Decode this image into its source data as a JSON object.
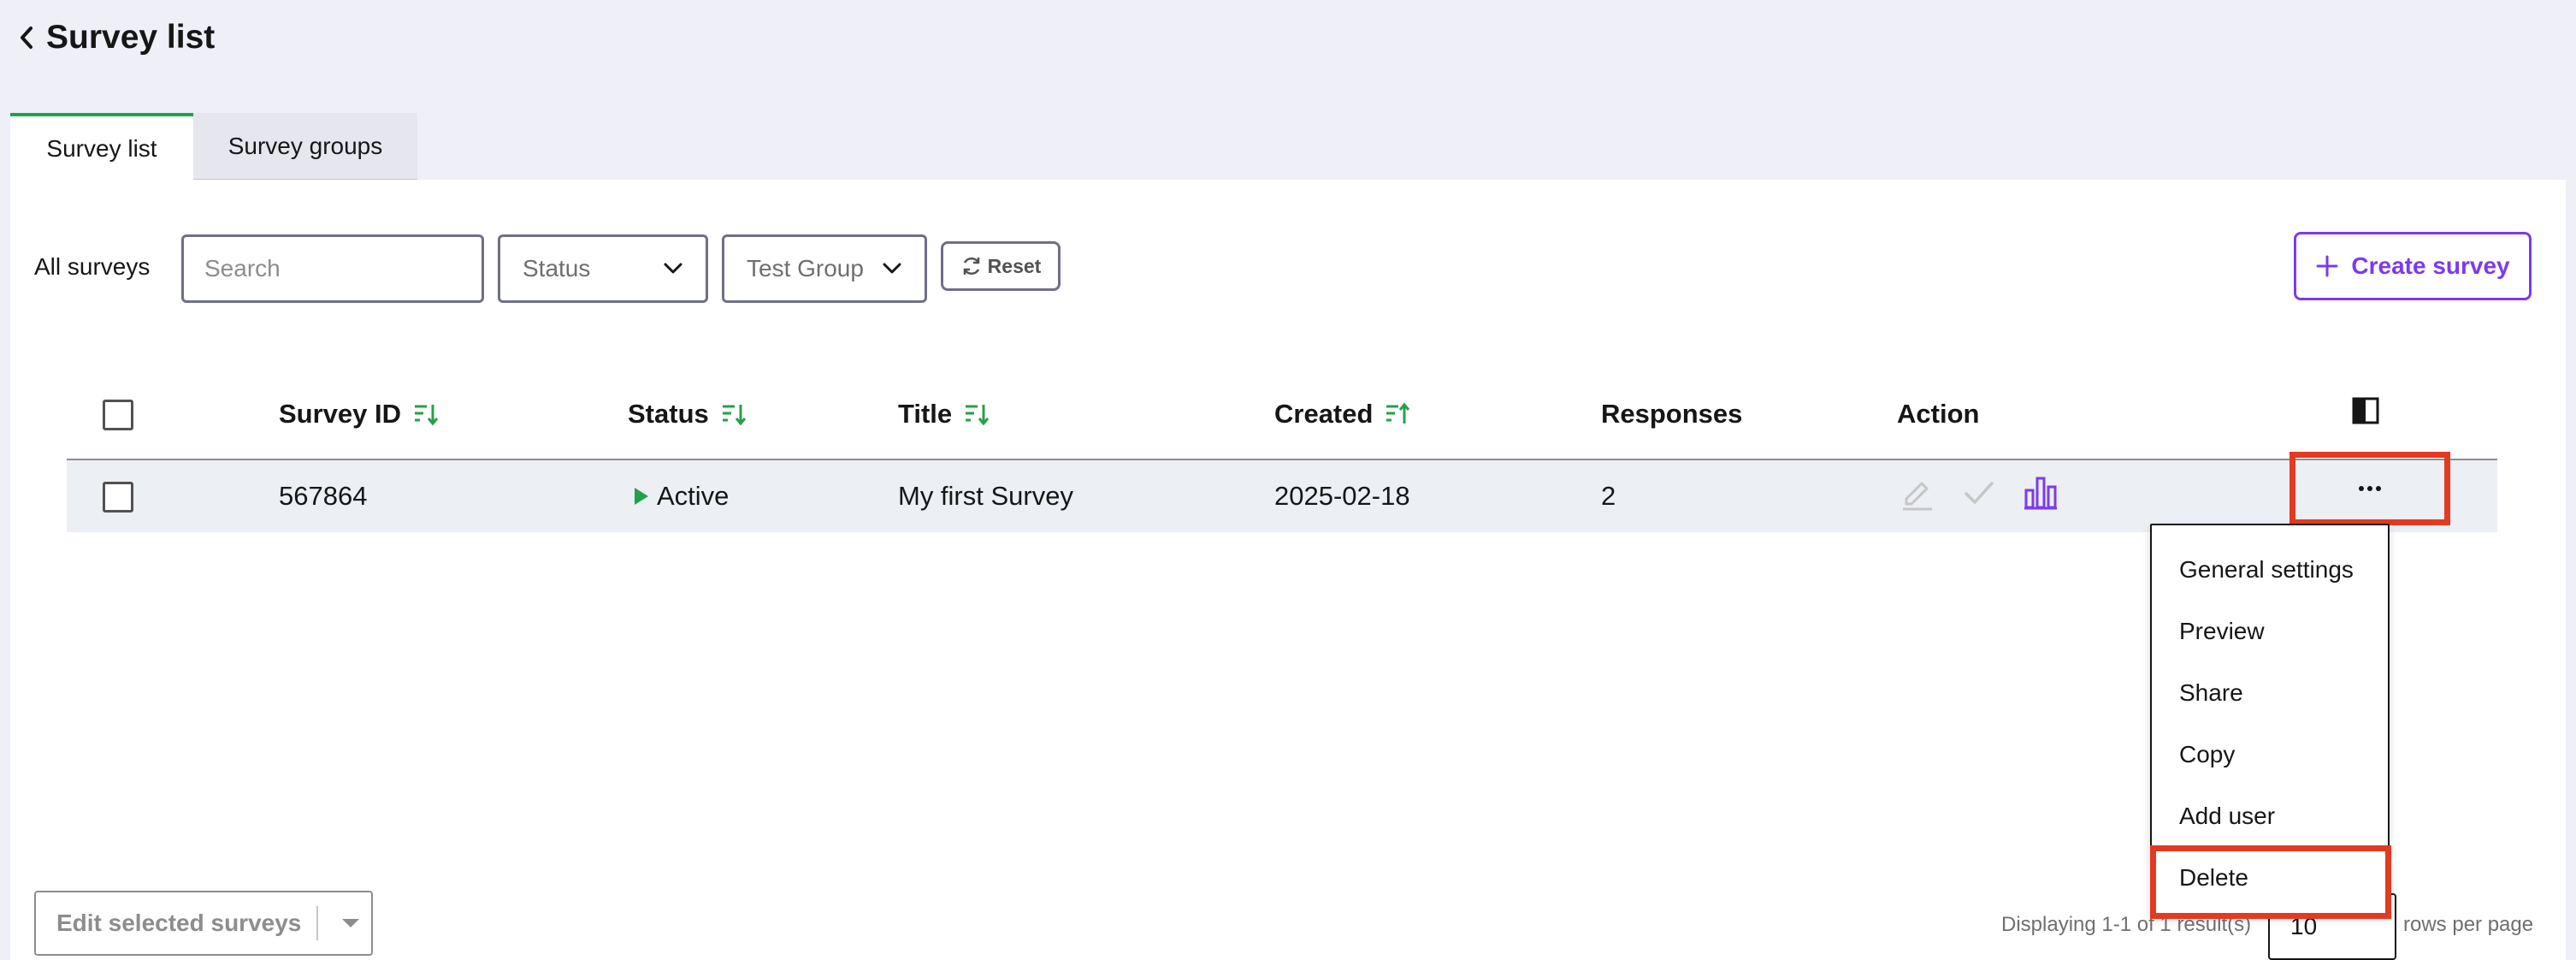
{
  "header": {
    "title": "Survey list"
  },
  "tabs": [
    {
      "label": "Survey list",
      "active": true
    },
    {
      "label": "Survey groups",
      "active": false
    }
  ],
  "filters": {
    "label": "All surveys",
    "search_placeholder": "Search",
    "status_label": "Status",
    "group_label": "Test Group",
    "reset_label": "Reset"
  },
  "create_button": {
    "label": "Create survey"
  },
  "table": {
    "columns": [
      {
        "label": "Survey ID",
        "sortable": true
      },
      {
        "label": "Status",
        "sortable": true
      },
      {
        "label": "Title",
        "sortable": true
      },
      {
        "label": "Created",
        "sortable": true
      },
      {
        "label": "Responses",
        "sortable": false
      },
      {
        "label": "Action",
        "sortable": false
      }
    ],
    "rows": [
      {
        "id": "567864",
        "status": "Active",
        "title": "My first Survey",
        "created": "2025-02-18",
        "responses": "2"
      }
    ]
  },
  "menu": {
    "items": [
      "General settings",
      "Preview",
      "Share",
      "Copy",
      "Add user",
      "Delete"
    ]
  },
  "footer": {
    "edit_selected": "Edit selected surveys",
    "displaying": "Displaying 1-1 of 1 result(s)",
    "page_size": "10",
    "rows_per_page": "rows per page"
  },
  "colors": {
    "accent_purple": "#7c3aed",
    "accent_green": "#24a148",
    "highlight_red": "#e23b22",
    "page_bg": "#eeeff7"
  }
}
